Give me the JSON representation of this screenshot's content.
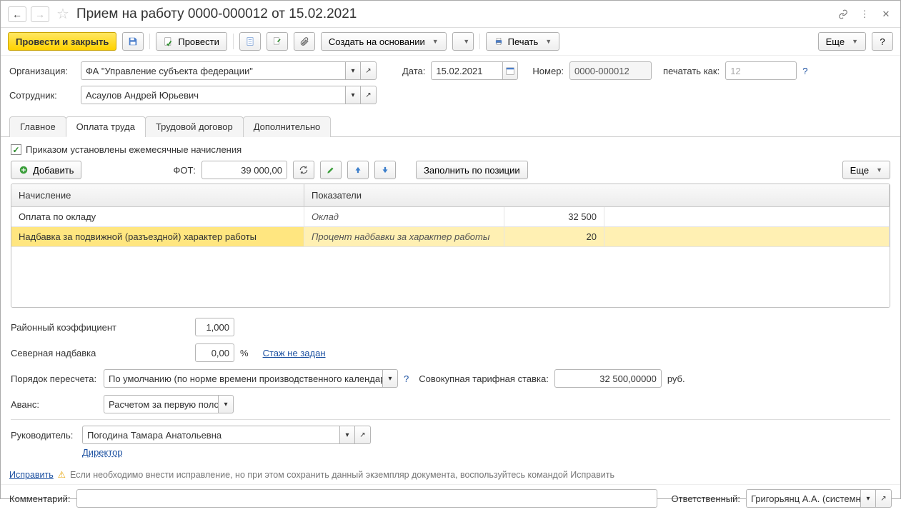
{
  "title": "Прием на работу 0000-000012 от 15.02.2021",
  "toolbar": {
    "post_close": "Провести и закрыть",
    "post": "Провести",
    "create_based": "Создать на основании",
    "print": "Печать",
    "more": "Еще",
    "help": "?"
  },
  "header": {
    "org_label": "Организация:",
    "org_value": "ФА \"Управление субъекта федерации\"",
    "date_label": "Дата:",
    "date_value": "15.02.2021",
    "number_label": "Номер:",
    "number_value": "0000-000012",
    "print_as_label": "печатать как:",
    "print_as_value": "12",
    "employee_label": "Сотрудник:",
    "employee_value": "Асаулов Андрей Юрьевич"
  },
  "tabs": {
    "main": "Главное",
    "pay": "Оплата труда",
    "contract": "Трудовой договор",
    "extra": "Дополнительно"
  },
  "pay_tab": {
    "monthly_checkbox": "Приказом установлены ежемесячные начисления",
    "add_btn": "Добавить",
    "fot_label": "ФОТ:",
    "fot_value": "39 000,00",
    "fill_btn": "Заполнить по позиции",
    "more_btn": "Еще",
    "grid": {
      "col1": "Начисление",
      "col2": "Показатели",
      "rows": [
        {
          "name": "Оплата по окладу",
          "param": "Оклад",
          "value": "32 500"
        },
        {
          "name": "Надбавка за подвижной (разъездной) характер работы",
          "param": "Процент надбавки за характер работы",
          "value": "20"
        }
      ]
    },
    "region_coef_label": "Районный коэффициент",
    "region_coef_value": "1,000",
    "north_label": "Северная надбавка",
    "north_value": "0,00",
    "north_unit": "%",
    "stage_link": "Стаж не задан",
    "recalc_label": "Порядок пересчета:",
    "recalc_value": "По умолчанию (по норме времени производственного календаря",
    "rate_label": "Совокупная тарифная ставка:",
    "rate_value": "32 500,00000",
    "rate_unit": "руб.",
    "advance_label": "Аванс:",
    "advance_value": "Расчетом за первую поло"
  },
  "signer": {
    "manager_label": "Руководитель:",
    "manager_value": "Погодина Тамара Анатольевна",
    "manager_role": "Директор"
  },
  "correction": {
    "fix_link": "Исправить",
    "warn_text": "Если необходимо внести исправление, но при этом сохранить данный экземпляр документа, воспользуйтесь командой Исправить"
  },
  "footer": {
    "comment_label": "Комментарий:",
    "resp_label": "Ответственный:",
    "resp_value": "Григорьянц А.А. (системн"
  }
}
